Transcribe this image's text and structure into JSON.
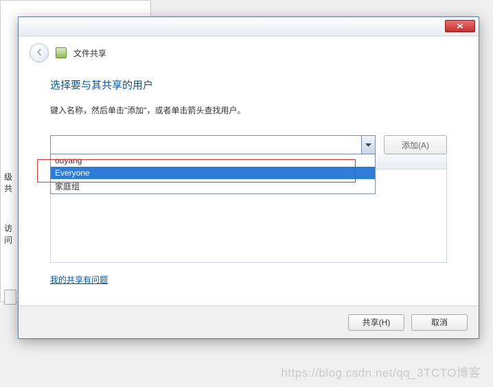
{
  "bg": {
    "item1": "级共",
    "item2": "访问"
  },
  "header": {
    "title": "文件共享"
  },
  "main": {
    "heading": "选择要与其共享的用户",
    "instruction": "键入名称，然后单击\"添加\"，或者单击箭头查找用户。",
    "add_button": "添加(A)",
    "dropdown_items": [
      "ouyang",
      "Everyone",
      "家庭组"
    ],
    "selected_index": 1,
    "help_link": "我的共享有问题"
  },
  "footer": {
    "share": "共享(H)",
    "cancel": "取消"
  },
  "watermark": "https://blog.csdn.net/qq_3TCTO博客"
}
